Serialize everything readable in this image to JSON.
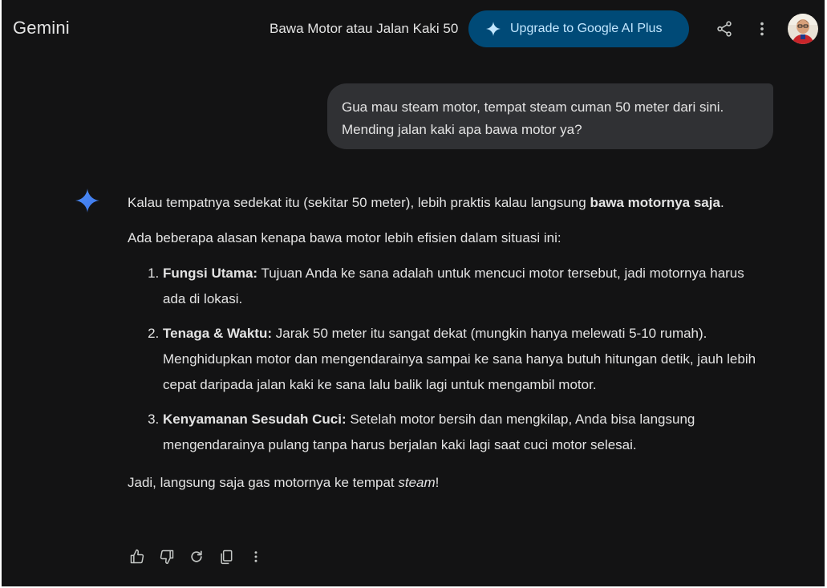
{
  "header": {
    "logo": "Gemini",
    "conversation_title": "Bawa Motor atau Jalan Kaki 50",
    "upgrade_label": "Upgrade to Google AI Plus",
    "icons": [
      "share-icon",
      "more-vert-icon",
      "avatar"
    ]
  },
  "user_message": {
    "text": "Gua mau steam motor, tempat steam cuman 50 meter dari sini. Mending jalan kaki apa bawa motor ya?"
  },
  "response": {
    "intro_text": "Kalau tempatnya sedekat itu (sekitar 50 meter), lebih praktis kalau langsung ",
    "intro_bold": "bawa motornya saja",
    "intro_end": ".",
    "reasons_intro": "Ada beberapa alasan kenapa bawa motor lebih efisien dalam situasi ini:",
    "items": [
      {
        "title": "Fungsi Utama:",
        "text": " Tujuan Anda ke sana adalah untuk mencuci motor tersebut, jadi motornya harus ada di lokasi."
      },
      {
        "title": "Tenaga & Waktu:",
        "text": " Jarak 50 meter itu sangat dekat (mungkin hanya melewati 5-10 rumah). Menghidupkan motor dan mengendarainya sampai ke sana hanya butuh hitungan detik, jauh lebih cepat daripada jalan kaki ke sana lalu balik lagi untuk mengambil motor."
      },
      {
        "title": "Kenyamanan Sesudah Cuci:",
        "text": " Setelah motor bersih dan mengkilap, Anda bisa langsung mengendarainya pulang tanpa harus berjalan kaki lagi saat cuci motor selesai."
      }
    ],
    "closing_text": "Jadi, langsung saja gas motornya ke tempat ",
    "closing_italic": "steam",
    "closing_end": "!"
  },
  "action_icons": [
    "thumb-up-icon",
    "thumb-down-icon",
    "regenerate-icon",
    "copy-icon",
    "more-vert-icon"
  ],
  "colors": {
    "background": "#131314",
    "text": "#e3e3e3",
    "user_bubble": "#303134",
    "upgrade_bg": "#004a77",
    "upgrade_text": "#c2e7ff",
    "gemini_spark": "#4285f4"
  }
}
